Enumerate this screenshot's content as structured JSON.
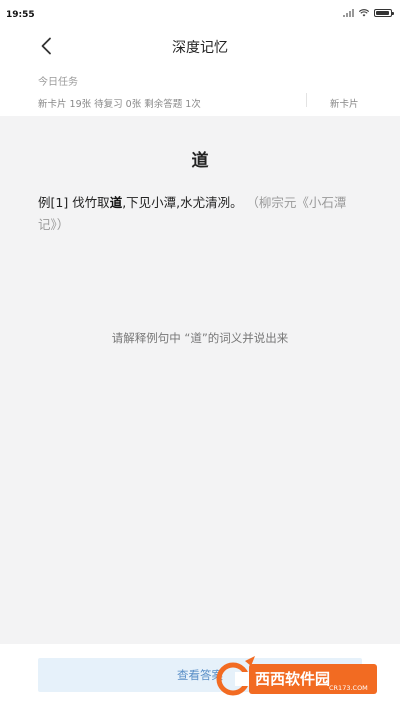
{
  "status_bar": {
    "time": "19:55"
  },
  "header": {
    "title": "深度记忆",
    "back_icon": "chevron-left-icon"
  },
  "today_task": {
    "label": "今日任务",
    "stats": "新卡片 19张 待复习 0张 剩余答题 1次",
    "tab_label": "新卡片"
  },
  "card": {
    "word": "道",
    "example_prefix": "例[1] 伐竹取",
    "example_keyword": "道",
    "example_suffix": ",下见小潭,水尤清冽。",
    "example_source": "（柳宗元《小石潭记》）",
    "prompt": "请解释例句中 “道”的词义并说出来"
  },
  "bottom": {
    "button_label": "查看答案"
  },
  "watermark": {
    "brand": "西西软件园",
    "domain": "CR173.COM"
  },
  "colors": {
    "accent": "#5a8fc7",
    "button_bg": "#e6f1fa",
    "card_bg": "#f3f3f4",
    "watermark_orange": "#f26b22"
  }
}
